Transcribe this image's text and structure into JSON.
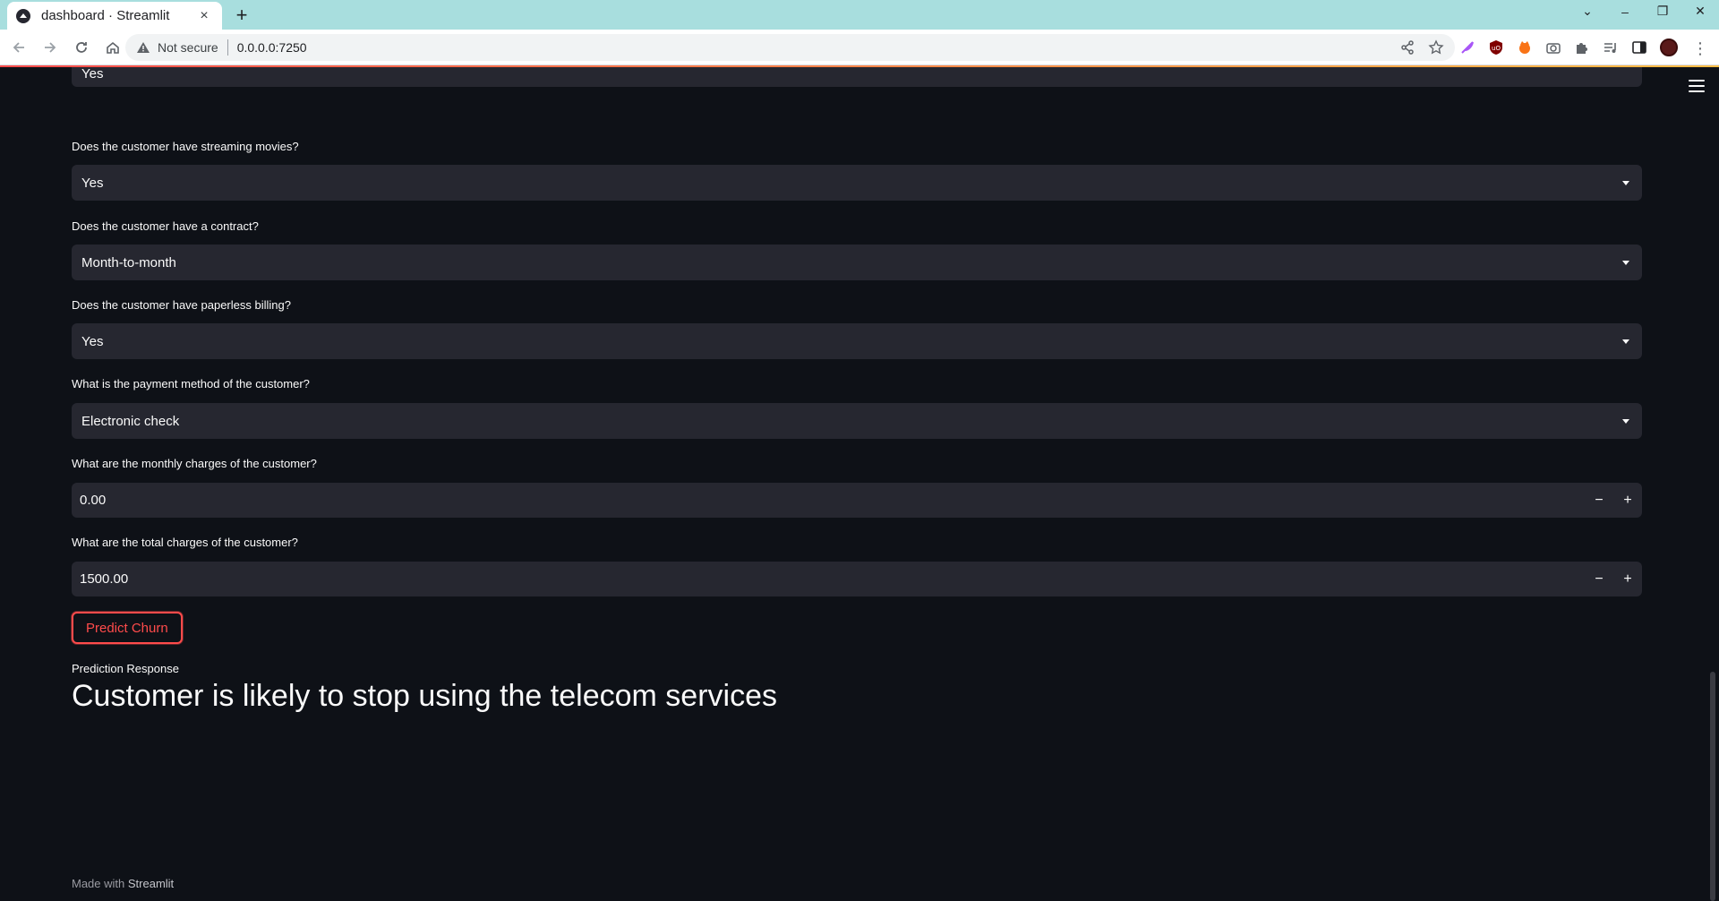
{
  "browser": {
    "tab_title": "dashboard · Streamlit",
    "tab_close": "×",
    "new_tab": "+",
    "security_label": "Not secure",
    "url": "0.0.0.0:7250",
    "window_controls": [
      "⌄",
      "–",
      "❐",
      "✕"
    ],
    "extension_icons": [
      "feather-icon",
      "ublock-icon",
      "fox-extension-icon",
      "camera-icon",
      "puzzle-icon",
      "media-control-icon",
      "sidepanel-icon"
    ]
  },
  "form": {
    "partial_field": {
      "value": "Yes"
    },
    "fields": [
      {
        "label": "Does the customer have streaming movies?",
        "value": "Yes"
      },
      {
        "label": "Does the customer have a contract?",
        "value": "Month-to-month"
      },
      {
        "label": "Does the customer have paperless billing?",
        "value": "Yes"
      },
      {
        "label": "What is the payment method of the customer?",
        "value": "Electronic check"
      }
    ],
    "numbers": [
      {
        "label": "What are the monthly charges of the customer?",
        "value": "0.00"
      },
      {
        "label": "What are the total charges of the customer?",
        "value": "1500.00"
      }
    ],
    "stepper_minus": "−",
    "stepper_plus": "+",
    "predict_button": "Predict Churn"
  },
  "result": {
    "label": "Prediction Response",
    "text": "Customer is likely to stop using the telecom services"
  },
  "footer": {
    "prefix": "Made with",
    "brand": "Streamlit"
  },
  "colors": {
    "background": "#0e1117",
    "widget": "#262730",
    "accent": "#ff4b4b",
    "text": "#fafafa",
    "tabbar": "#a8dede"
  }
}
